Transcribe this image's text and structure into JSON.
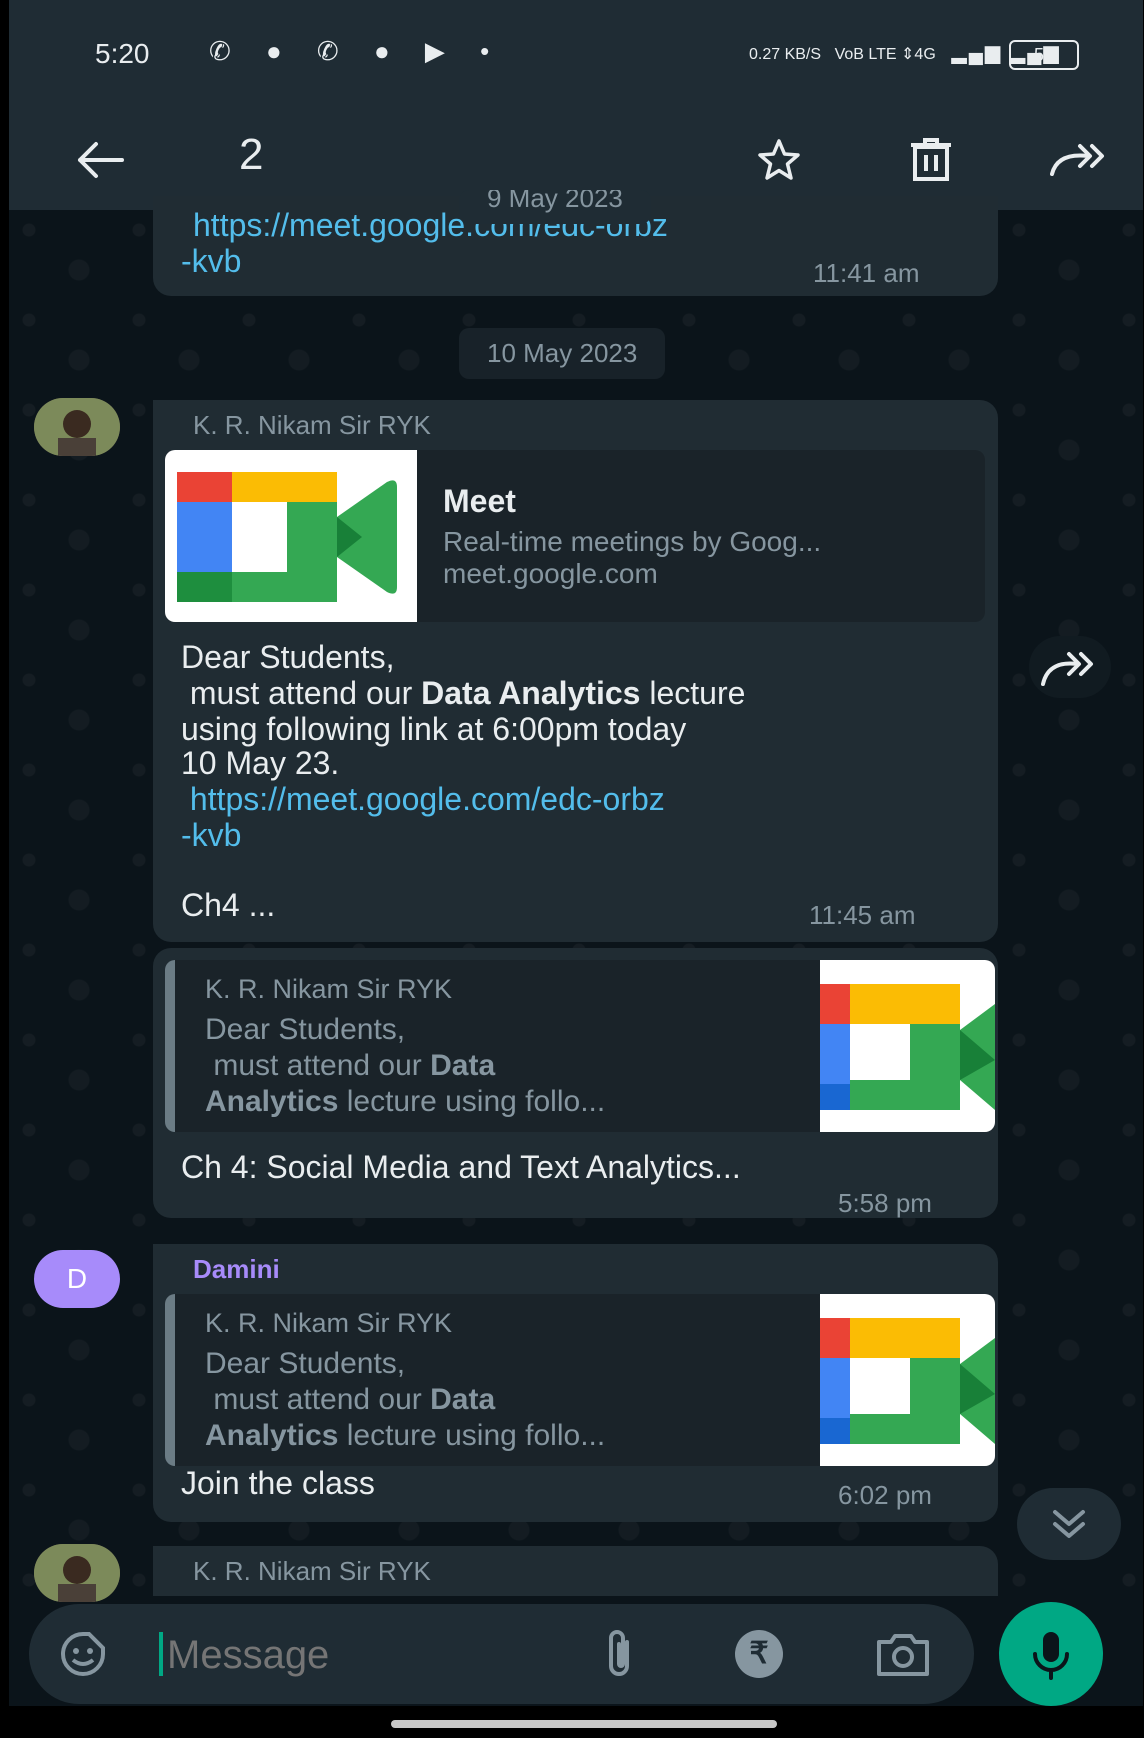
{
  "status_bar": {
    "time": "5:20",
    "app_icons": "✆ ● ✆ ● ▶ •",
    "net_speed": "0.27 KB/S",
    "network": "VoB LTE ⇕4G",
    "battery": "59"
  },
  "app_bar": {
    "selected_count": "2",
    "icons": [
      "back-arrow-icon",
      "star-icon",
      "delete-icon",
      "forward-icon"
    ]
  },
  "chat": {
    "prev_date_chip": "9 May 2023",
    "msg0": {
      "link_line1": "https://meet.google.com/edc-orbz",
      "link_line2": "-kvb",
      "time": "11:41 am"
    },
    "date_chip": "10 May 2023",
    "msg1": {
      "sender": "K. R. Nikam Sir RYK",
      "preview_title": "Meet",
      "preview_desc": "Real-time meetings by Goog...",
      "preview_domain": "meet.google.com",
      "line1": "Dear Students,",
      "line2_pre": " must attend our ",
      "line2_bold": "Data Analytics",
      "line2_post": " lecture",
      "line3": "using following link at 6:00pm today",
      "line4": "10 May 23.",
      "link_line1": " https://meet.google.com/edc-orbz",
      "link_line2": "-kvb",
      "line5": "Ch4 ...",
      "time": "11:45 am"
    },
    "msg2": {
      "quote_sender": "K. R. Nikam Sir RYK",
      "quote_line1": "Dear Students,",
      "quote_line2_pre": " must attend our ",
      "quote_line2_bold": "Data",
      "quote_line3_bold": "Analytics",
      "quote_line3_post": " lecture using follo...",
      "text": "Ch 4: Social Media and Text Analytics...",
      "time": "5:58 pm"
    },
    "msg3": {
      "avatar_letter": "D",
      "sender": "Damini",
      "quote_sender": "K. R. Nikam Sir RYK",
      "quote_line1": "Dear Students,",
      "quote_line2_pre": " must attend our ",
      "quote_line2_bold": "Data",
      "quote_line3_bold": "Analytics",
      "quote_line3_post": " lecture using follo...",
      "text": "Join the class",
      "time": "6:02 pm"
    },
    "msg4": {
      "sender": "K. R. Nikam Sir RYK"
    }
  },
  "composer": {
    "placeholder": "Message"
  },
  "colors": {
    "background": "#0b141a",
    "bubble": "#202c33",
    "link": "#53bdeb",
    "accent": "#00a884",
    "sender_purple": "#a78bfa"
  }
}
